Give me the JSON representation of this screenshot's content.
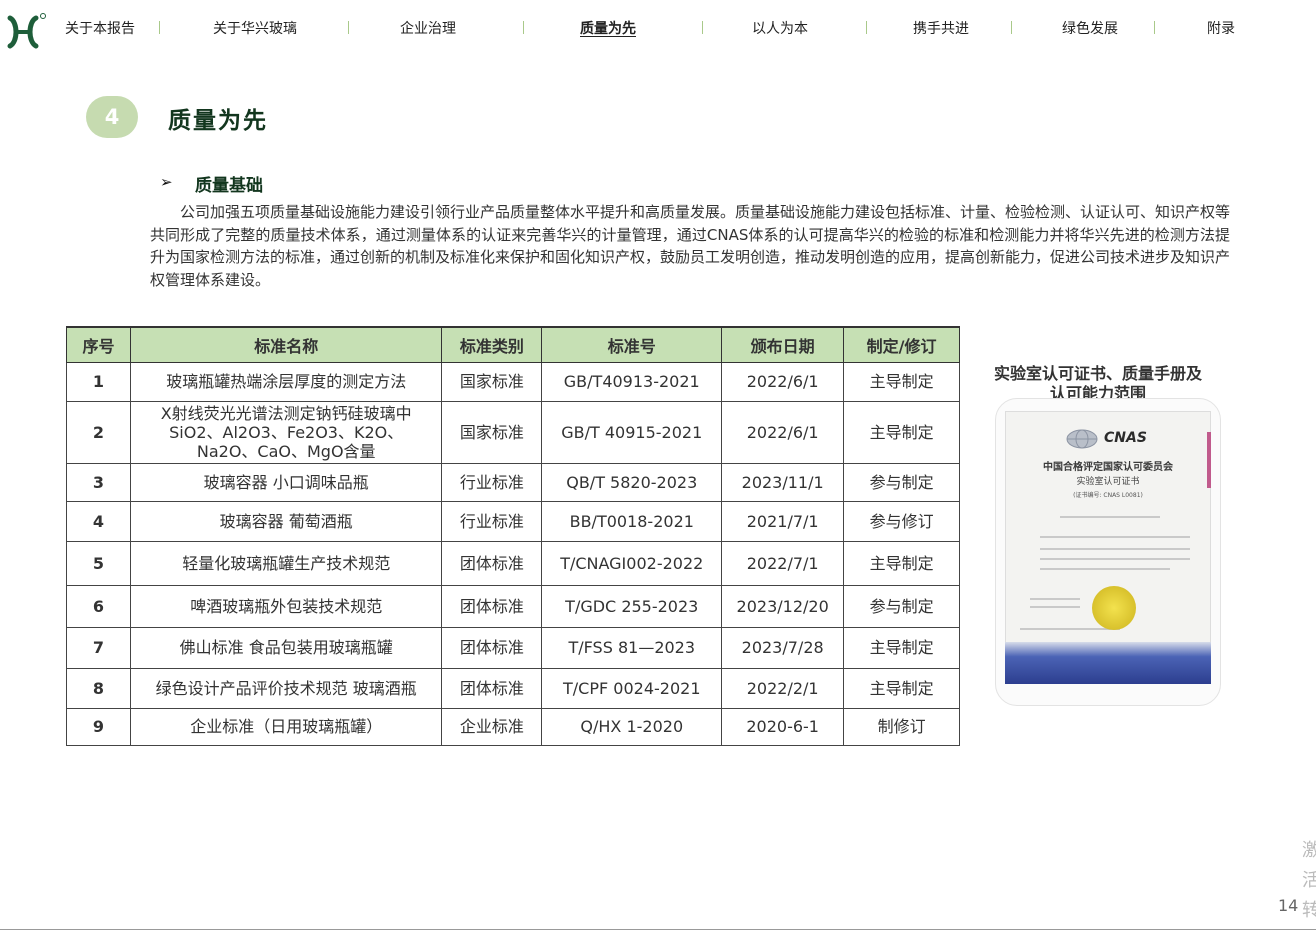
{
  "nav": {
    "items": [
      {
        "label": "关于本报告"
      },
      {
        "label": "关于华兴玻璃"
      },
      {
        "label": "企业治理"
      },
      {
        "label": "质量为先",
        "active": true
      },
      {
        "label": "以人为本"
      },
      {
        "label": "携手共进"
      },
      {
        "label": "绿色发展"
      },
      {
        "label": "附录"
      }
    ],
    "accent_color": "#a9c98a"
  },
  "section": {
    "number": "4",
    "title": "质量为先",
    "badge_color": "#c6dbb0",
    "title_color": "#12361e"
  },
  "subsection": {
    "arrow": "➢",
    "title": "质量基础",
    "paragraph": "公司加强五项质量基础设施能力建设引领行业产品质量整体水平提升和高质量发展。质量基础设施能力建设包括标准、计量、检验检测、认证认可、知识产权等共同形成了完整的质量技术体系，通过测量体系的认证来完善华兴的计量管理，通过CNAS体系的认可提高华兴的检验的标准和检测能力并将华兴先进的检测方法提升为国家检测方法的标准，通过创新的机制及标准化来保护和固化知识产权，鼓励员工发明创造，推动发明创造的应用，提高创新能力，促进公司技术进步及知识产权管理体系建设。"
  },
  "table": {
    "header_color": "#c6e0b4",
    "headers": [
      "序号",
      "标准名称",
      "标准类别",
      "标准号",
      "颁布日期",
      "制定/修订"
    ],
    "rows": [
      {
        "no": "1",
        "name": "玻璃瓶罐热端涂层厚度的测定方法",
        "category": "国家标准",
        "code": "GB/T40913-2021",
        "date": "2022/6/1",
        "role": "主导制定"
      },
      {
        "no": "2",
        "name": "X射线荧光光谱法测定钠钙硅玻璃中SiO2、Al2O3、Fe2O3、K2O、Na2O、CaO、MgO含量",
        "category": "国家标准",
        "code": "GB/T 40915-2021",
        "date": "2022/6/1",
        "role": "主导制定"
      },
      {
        "no": "3",
        "name": "玻璃容器  小口调味品瓶",
        "category": "行业标准",
        "code": "QB/T 5820-2023",
        "date": "2023/11/1",
        "role": "参与制定"
      },
      {
        "no": "4",
        "name": "玻璃容器  葡萄酒瓶",
        "category": "行业标准",
        "code": "BB/T0018-2021",
        "date": "2021/7/1",
        "role": "参与修订"
      },
      {
        "no": "5",
        "name": "轻量化玻璃瓶罐生产技术规范",
        "category": "团体标准",
        "code": "T/CNAGI002-2022",
        "date": "2022/7/1",
        "role": "主导制定"
      },
      {
        "no": "6",
        "name": "啤酒玻璃瓶外包装技术规范",
        "category": "团体标准",
        "code": "T/GDC 255-2023",
        "date": "2023/12/20",
        "role": "参与制定"
      },
      {
        "no": "7",
        "name": "佛山标准 食品包装用玻璃瓶罐",
        "category": "团体标准",
        "code": "T/FSS 81—2023",
        "date": "2023/7/28",
        "role": "主导制定"
      },
      {
        "no": "8",
        "name": "绿色设计产品评价技术规范  玻璃酒瓶",
        "category": "团体标准",
        "code": "T/CPF 0024-2021",
        "date": "2022/2/1",
        "role": "主导制定"
      },
      {
        "no": "9",
        "name": "企业标准（日用玻璃瓶罐）",
        "category": "企业标准",
        "code": "Q/HX 1-2020",
        "date": "2020-6-1",
        "role": "制修订"
      }
    ]
  },
  "certificate": {
    "caption": "实验室认可证书、质量手册及认可能力范围",
    "logo_text": "CNAS",
    "org_text": "中国合格评定国家认可委员会",
    "doc_title": "实验室认可证书",
    "cert_no": "(证书编号: CNAS L0081)"
  },
  "page_number": "14",
  "watermark": "激活转"
}
